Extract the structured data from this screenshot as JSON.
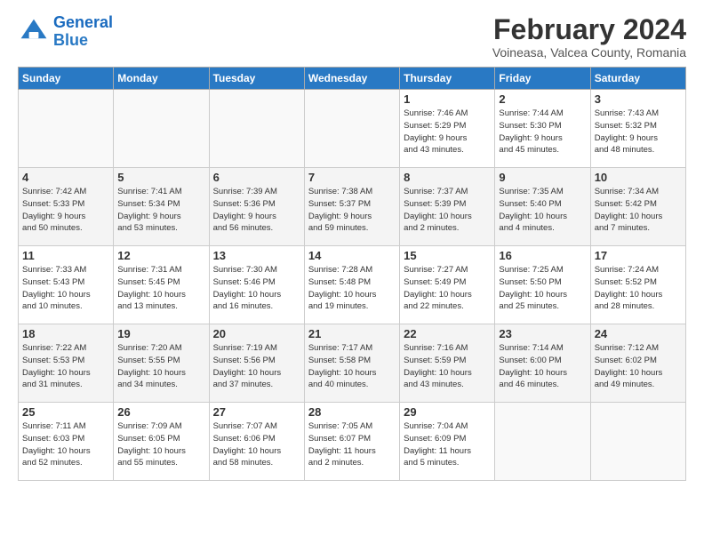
{
  "header": {
    "logo_line1": "General",
    "logo_line2": "Blue",
    "title": "February 2024",
    "subtitle": "Voineasa, Valcea County, Romania"
  },
  "days_of_week": [
    "Sunday",
    "Monday",
    "Tuesday",
    "Wednesday",
    "Thursday",
    "Friday",
    "Saturday"
  ],
  "weeks": [
    [
      {
        "day": "",
        "info": ""
      },
      {
        "day": "",
        "info": ""
      },
      {
        "day": "",
        "info": ""
      },
      {
        "day": "",
        "info": ""
      },
      {
        "day": "1",
        "info": "Sunrise: 7:46 AM\nSunset: 5:29 PM\nDaylight: 9 hours\nand 43 minutes."
      },
      {
        "day": "2",
        "info": "Sunrise: 7:44 AM\nSunset: 5:30 PM\nDaylight: 9 hours\nand 45 minutes."
      },
      {
        "day": "3",
        "info": "Sunrise: 7:43 AM\nSunset: 5:32 PM\nDaylight: 9 hours\nand 48 minutes."
      }
    ],
    [
      {
        "day": "4",
        "info": "Sunrise: 7:42 AM\nSunset: 5:33 PM\nDaylight: 9 hours\nand 50 minutes."
      },
      {
        "day": "5",
        "info": "Sunrise: 7:41 AM\nSunset: 5:34 PM\nDaylight: 9 hours\nand 53 minutes."
      },
      {
        "day": "6",
        "info": "Sunrise: 7:39 AM\nSunset: 5:36 PM\nDaylight: 9 hours\nand 56 minutes."
      },
      {
        "day": "7",
        "info": "Sunrise: 7:38 AM\nSunset: 5:37 PM\nDaylight: 9 hours\nand 59 minutes."
      },
      {
        "day": "8",
        "info": "Sunrise: 7:37 AM\nSunset: 5:39 PM\nDaylight: 10 hours\nand 2 minutes."
      },
      {
        "day": "9",
        "info": "Sunrise: 7:35 AM\nSunset: 5:40 PM\nDaylight: 10 hours\nand 4 minutes."
      },
      {
        "day": "10",
        "info": "Sunrise: 7:34 AM\nSunset: 5:42 PM\nDaylight: 10 hours\nand 7 minutes."
      }
    ],
    [
      {
        "day": "11",
        "info": "Sunrise: 7:33 AM\nSunset: 5:43 PM\nDaylight: 10 hours\nand 10 minutes."
      },
      {
        "day": "12",
        "info": "Sunrise: 7:31 AM\nSunset: 5:45 PM\nDaylight: 10 hours\nand 13 minutes."
      },
      {
        "day": "13",
        "info": "Sunrise: 7:30 AM\nSunset: 5:46 PM\nDaylight: 10 hours\nand 16 minutes."
      },
      {
        "day": "14",
        "info": "Sunrise: 7:28 AM\nSunset: 5:48 PM\nDaylight: 10 hours\nand 19 minutes."
      },
      {
        "day": "15",
        "info": "Sunrise: 7:27 AM\nSunset: 5:49 PM\nDaylight: 10 hours\nand 22 minutes."
      },
      {
        "day": "16",
        "info": "Sunrise: 7:25 AM\nSunset: 5:50 PM\nDaylight: 10 hours\nand 25 minutes."
      },
      {
        "day": "17",
        "info": "Sunrise: 7:24 AM\nSunset: 5:52 PM\nDaylight: 10 hours\nand 28 minutes."
      }
    ],
    [
      {
        "day": "18",
        "info": "Sunrise: 7:22 AM\nSunset: 5:53 PM\nDaylight: 10 hours\nand 31 minutes."
      },
      {
        "day": "19",
        "info": "Sunrise: 7:20 AM\nSunset: 5:55 PM\nDaylight: 10 hours\nand 34 minutes."
      },
      {
        "day": "20",
        "info": "Sunrise: 7:19 AM\nSunset: 5:56 PM\nDaylight: 10 hours\nand 37 minutes."
      },
      {
        "day": "21",
        "info": "Sunrise: 7:17 AM\nSunset: 5:58 PM\nDaylight: 10 hours\nand 40 minutes."
      },
      {
        "day": "22",
        "info": "Sunrise: 7:16 AM\nSunset: 5:59 PM\nDaylight: 10 hours\nand 43 minutes."
      },
      {
        "day": "23",
        "info": "Sunrise: 7:14 AM\nSunset: 6:00 PM\nDaylight: 10 hours\nand 46 minutes."
      },
      {
        "day": "24",
        "info": "Sunrise: 7:12 AM\nSunset: 6:02 PM\nDaylight: 10 hours\nand 49 minutes."
      }
    ],
    [
      {
        "day": "25",
        "info": "Sunrise: 7:11 AM\nSunset: 6:03 PM\nDaylight: 10 hours\nand 52 minutes."
      },
      {
        "day": "26",
        "info": "Sunrise: 7:09 AM\nSunset: 6:05 PM\nDaylight: 10 hours\nand 55 minutes."
      },
      {
        "day": "27",
        "info": "Sunrise: 7:07 AM\nSunset: 6:06 PM\nDaylight: 10 hours\nand 58 minutes."
      },
      {
        "day": "28",
        "info": "Sunrise: 7:05 AM\nSunset: 6:07 PM\nDaylight: 11 hours\nand 2 minutes."
      },
      {
        "day": "29",
        "info": "Sunrise: 7:04 AM\nSunset: 6:09 PM\nDaylight: 11 hours\nand 5 minutes."
      },
      {
        "day": "",
        "info": ""
      },
      {
        "day": "",
        "info": ""
      }
    ]
  ]
}
